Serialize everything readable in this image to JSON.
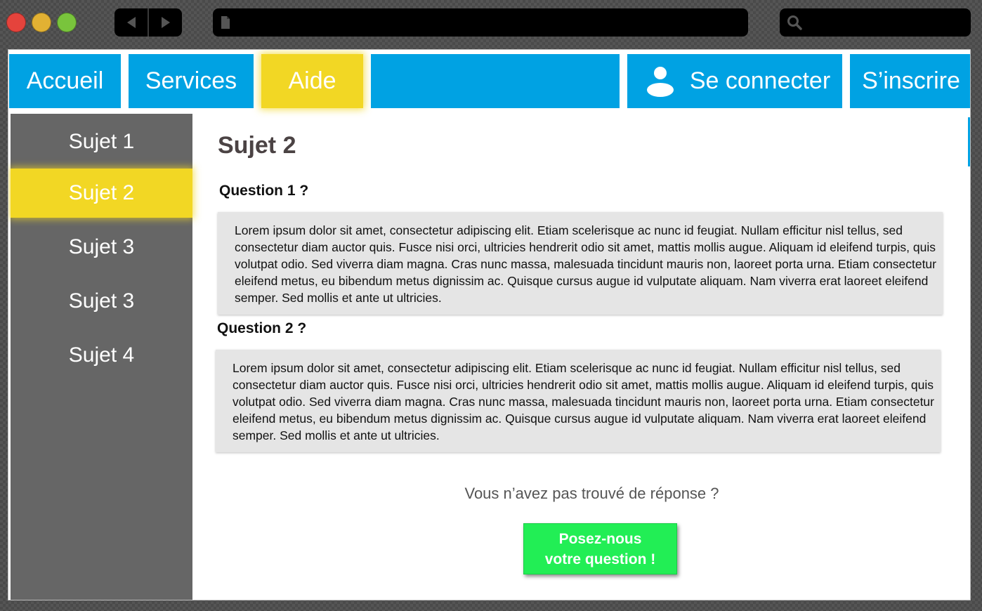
{
  "browser": {
    "traffic_lights": {
      "close": "#e5433c",
      "minimize": "#e2b133",
      "maximize": "#79c43c"
    },
    "url": "",
    "search": ""
  },
  "nav": {
    "accueil": "Accueil",
    "services": "Services",
    "aide": "Aide",
    "connect": "Se connecter",
    "inscrire": "S’inscrire",
    "active": "Aide"
  },
  "sidebar": {
    "items": [
      {
        "label": "Sujet 1"
      },
      {
        "label": "Sujet 2"
      },
      {
        "label": "Sujet 3"
      },
      {
        "label": "Sujet 3"
      },
      {
        "label": "Sujet 4"
      }
    ],
    "active_index": 1
  },
  "main": {
    "title": "Sujet 2",
    "questions": [
      {
        "title": "Question 1 ?",
        "answer": "Lorem ipsum dolor sit amet, consectetur adipiscing elit. Etiam scelerisque ac nunc id feugiat. Nullam efficitur nisl tellus, sed consectetur diam auctor quis. Fusce nisi orci, ultricies hendrerit odio sit amet, mattis mollis augue. Aliquam id eleifend turpis, quis volutpat odio. Sed viverra diam magna. Cras nunc massa, malesuada tincidunt mauris non, laoreet porta urna. Etiam consectetur eleifend metus, eu bibendum metus dignissim ac. Quisque cursus augue id vulputate aliquam. Nam viverra erat laoreet eleifend semper. Sed mollis et ante ut ultricies."
      },
      {
        "title": "Question 2 ?",
        "answer": "Lorem ipsum dolor sit amet, consectetur adipiscing elit. Etiam scelerisque ac nunc id feugiat. Nullam efficitur nisl tellus, sed consectetur diam auctor quis. Fusce nisi orci, ultricies hendrerit odio sit amet, mattis mollis augue. Aliquam id eleifend turpis, quis volutpat odio. Sed viverra diam magna. Cras nunc massa, malesuada tincidunt mauris non, laoreet porta urna. Etiam consectetur eleifend metus, eu bibendum metus dignissim ac. Quisque cursus augue id vulputate aliquam. Nam viverra erat laoreet eleifend semper. Sed mollis et ante ut ultricies."
      }
    ],
    "no_answer_text": "Vous n’avez pas trouvé de réponse ?",
    "cta_label": "Posez-nous\nvotre question !"
  },
  "colors": {
    "nav_blue": "#00a2e3",
    "active_yellow": "#f2d724",
    "sidebar_gray": "#666666",
    "cta_green": "#22ee55",
    "answer_bg": "#e5e5e5"
  },
  "icons": {
    "back": "arrow-left-icon",
    "forward": "arrow-right-icon",
    "page": "document-icon",
    "search": "search-icon",
    "user": "user-icon"
  }
}
